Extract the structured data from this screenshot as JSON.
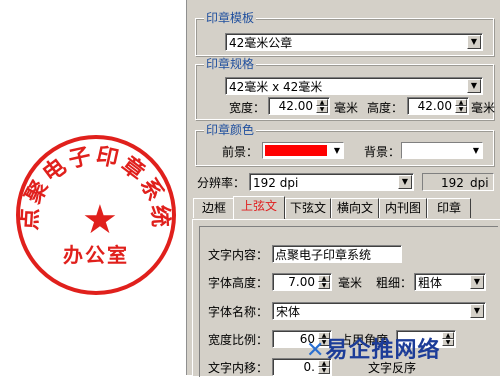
{
  "seal": {
    "arc_text": "点聚电子印章系统",
    "bottom_text": "办公室",
    "star": "★",
    "color": "#e0201c"
  },
  "template_group": {
    "title": "印章模板",
    "value": "42毫米公章"
  },
  "spec_group": {
    "title": "印章规格",
    "value": "42毫米 x 42毫米",
    "width_label": "宽度：",
    "width_value": "42.00",
    "width_unit": "毫米",
    "height_label": "高度：",
    "height_value": "42.00",
    "height_unit": "毫米"
  },
  "color_group": {
    "title": "印章颜色",
    "fg_label": "前景：",
    "fg_color": "#ff0000",
    "bg_label": "背景：",
    "bg_color": "#ffffff"
  },
  "resolution": {
    "label": "分辨率：",
    "value": "192 dpi",
    "readout_value": "192",
    "readout_unit": "dpi"
  },
  "tabs": [
    {
      "label": "边框"
    },
    {
      "label": "上弦文"
    },
    {
      "label": "下弦文"
    },
    {
      "label": "横向文"
    },
    {
      "label": "内刊图"
    },
    {
      "label": "印章"
    }
  ],
  "upper_text_tab": {
    "content_label": "文字内容：",
    "content_value": "点聚电子印章系统",
    "font_height_label": "字体高度：",
    "font_height_value": "7.00",
    "font_height_unit": "毫米",
    "weight_label": "粗细：",
    "weight_value": "粗体",
    "font_name_label": "字体名称：",
    "font_name_value": "宋体",
    "width_ratio_label": "宽度比例：",
    "width_ratio_value": "60",
    "angle_label": "占用角度",
    "offset_label": "文字内移：",
    "offset_value": "0.",
    "reverse_label": "文字反序"
  },
  "watermark": "易企推网络",
  "icons": [
    "dropdown-arrow-icon",
    "spin-up-icon",
    "spin-down-icon",
    "star-icon"
  ]
}
